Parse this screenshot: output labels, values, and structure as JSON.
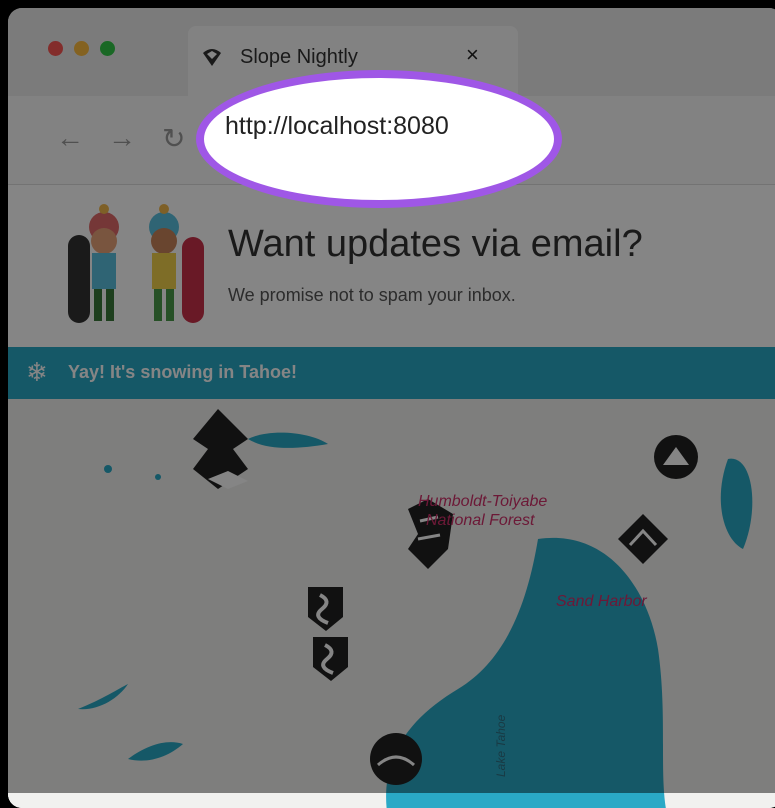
{
  "browser": {
    "tab_title": "Slope Nightly",
    "url": "http://localhost:8080",
    "close": "×"
  },
  "newsletter": {
    "headline": "Want updates via email?",
    "subline": "We promise not to spam your inbox."
  },
  "banner": {
    "text": "Yay! It's snowing in Tahoe!",
    "icon": "❄"
  },
  "map": {
    "labels": [
      "Humboldt-Toiyabe",
      "National Forest",
      "Sand Harbor",
      "Lake Tahoe"
    ],
    "colors": {
      "water": "#2aa9c6",
      "label": "#d0306a",
      "land": "#f1f1ef"
    }
  }
}
